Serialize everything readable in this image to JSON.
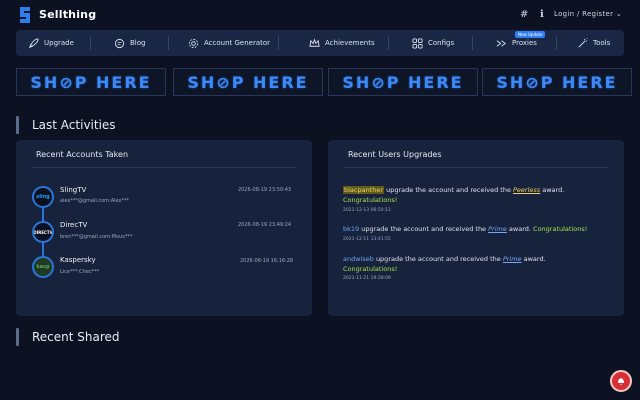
{
  "header": {
    "brand": "Sellthing",
    "hash": "#",
    "info": "ℹ",
    "login": "Login / Register ⌄"
  },
  "nav": {
    "items": [
      {
        "label": "Upgrade",
        "icon": "rocket-icon"
      },
      {
        "label": "Blog",
        "icon": "blog-icon"
      },
      {
        "label": "Account Generator",
        "icon": "cog-icon"
      },
      {
        "label": "Achievements",
        "icon": "crown-icon"
      },
      {
        "label": "Configs",
        "icon": "configs-icon"
      },
      {
        "label": "Proxies",
        "icon": "proxies-icon"
      },
      {
        "label": "Tools",
        "icon": "wand-icon"
      }
    ],
    "badge": "New Update"
  },
  "banners": [
    "SH⊘P HERE",
    "SH⊘P HERE",
    "SH⊘P HERE",
    "SH⊘P HERE"
  ],
  "sections": {
    "last_activities": "Last Activities",
    "recent_shared": "Recent Shared"
  },
  "accounts_card": {
    "title": "Recent Accounts Taken",
    "items": [
      {
        "name": "SlingTV",
        "cred": "alex***@gmail.com:Alex***",
        "time": "2026-08-19 23:50:43",
        "logo_text": "sling",
        "logo_color": "#2a9df4"
      },
      {
        "name": "DirecTV",
        "cred": "bren***@gmail.com:Mous***",
        "time": "2026-08-19 23:49:24",
        "logo_text": "DIRECTV",
        "logo_color": "#1f3f8a"
      },
      {
        "name": "Kaspersky",
        "cred": "Lice***:Chec***",
        "time": "2026-08-19 16:16:28",
        "logo_text": "kasp",
        "logo_color": "#2f6a3a"
      }
    ]
  },
  "upgrades_card": {
    "title": "Recent Users Upgrades",
    "items": [
      {
        "user": "blacpanther",
        "text": " upgrade the account and received the ",
        "award": "Peerless",
        "award_suffix": " award.",
        "congrats": "Congratulations!",
        "time": "2021-12-13 06:50:13"
      },
      {
        "user": "bk19",
        "text": " upgrade the account and received the ",
        "award": "Prime",
        "award_suffix": " award. ",
        "congrats": "Congratulations!",
        "time": "2021-12-11 13:41:55"
      },
      {
        "user": "andwiseb",
        "text": " upgrade the account and received the ",
        "award": "Prime",
        "award_suffix": " award.",
        "congrats": "Congratulations!",
        "time": "2021-11-21 19:28:09"
      }
    ]
  },
  "colors": {
    "background": "#0c1222",
    "card": "#17233d",
    "accent": "#2a76d6",
    "congrats": "#a8e04a"
  }
}
